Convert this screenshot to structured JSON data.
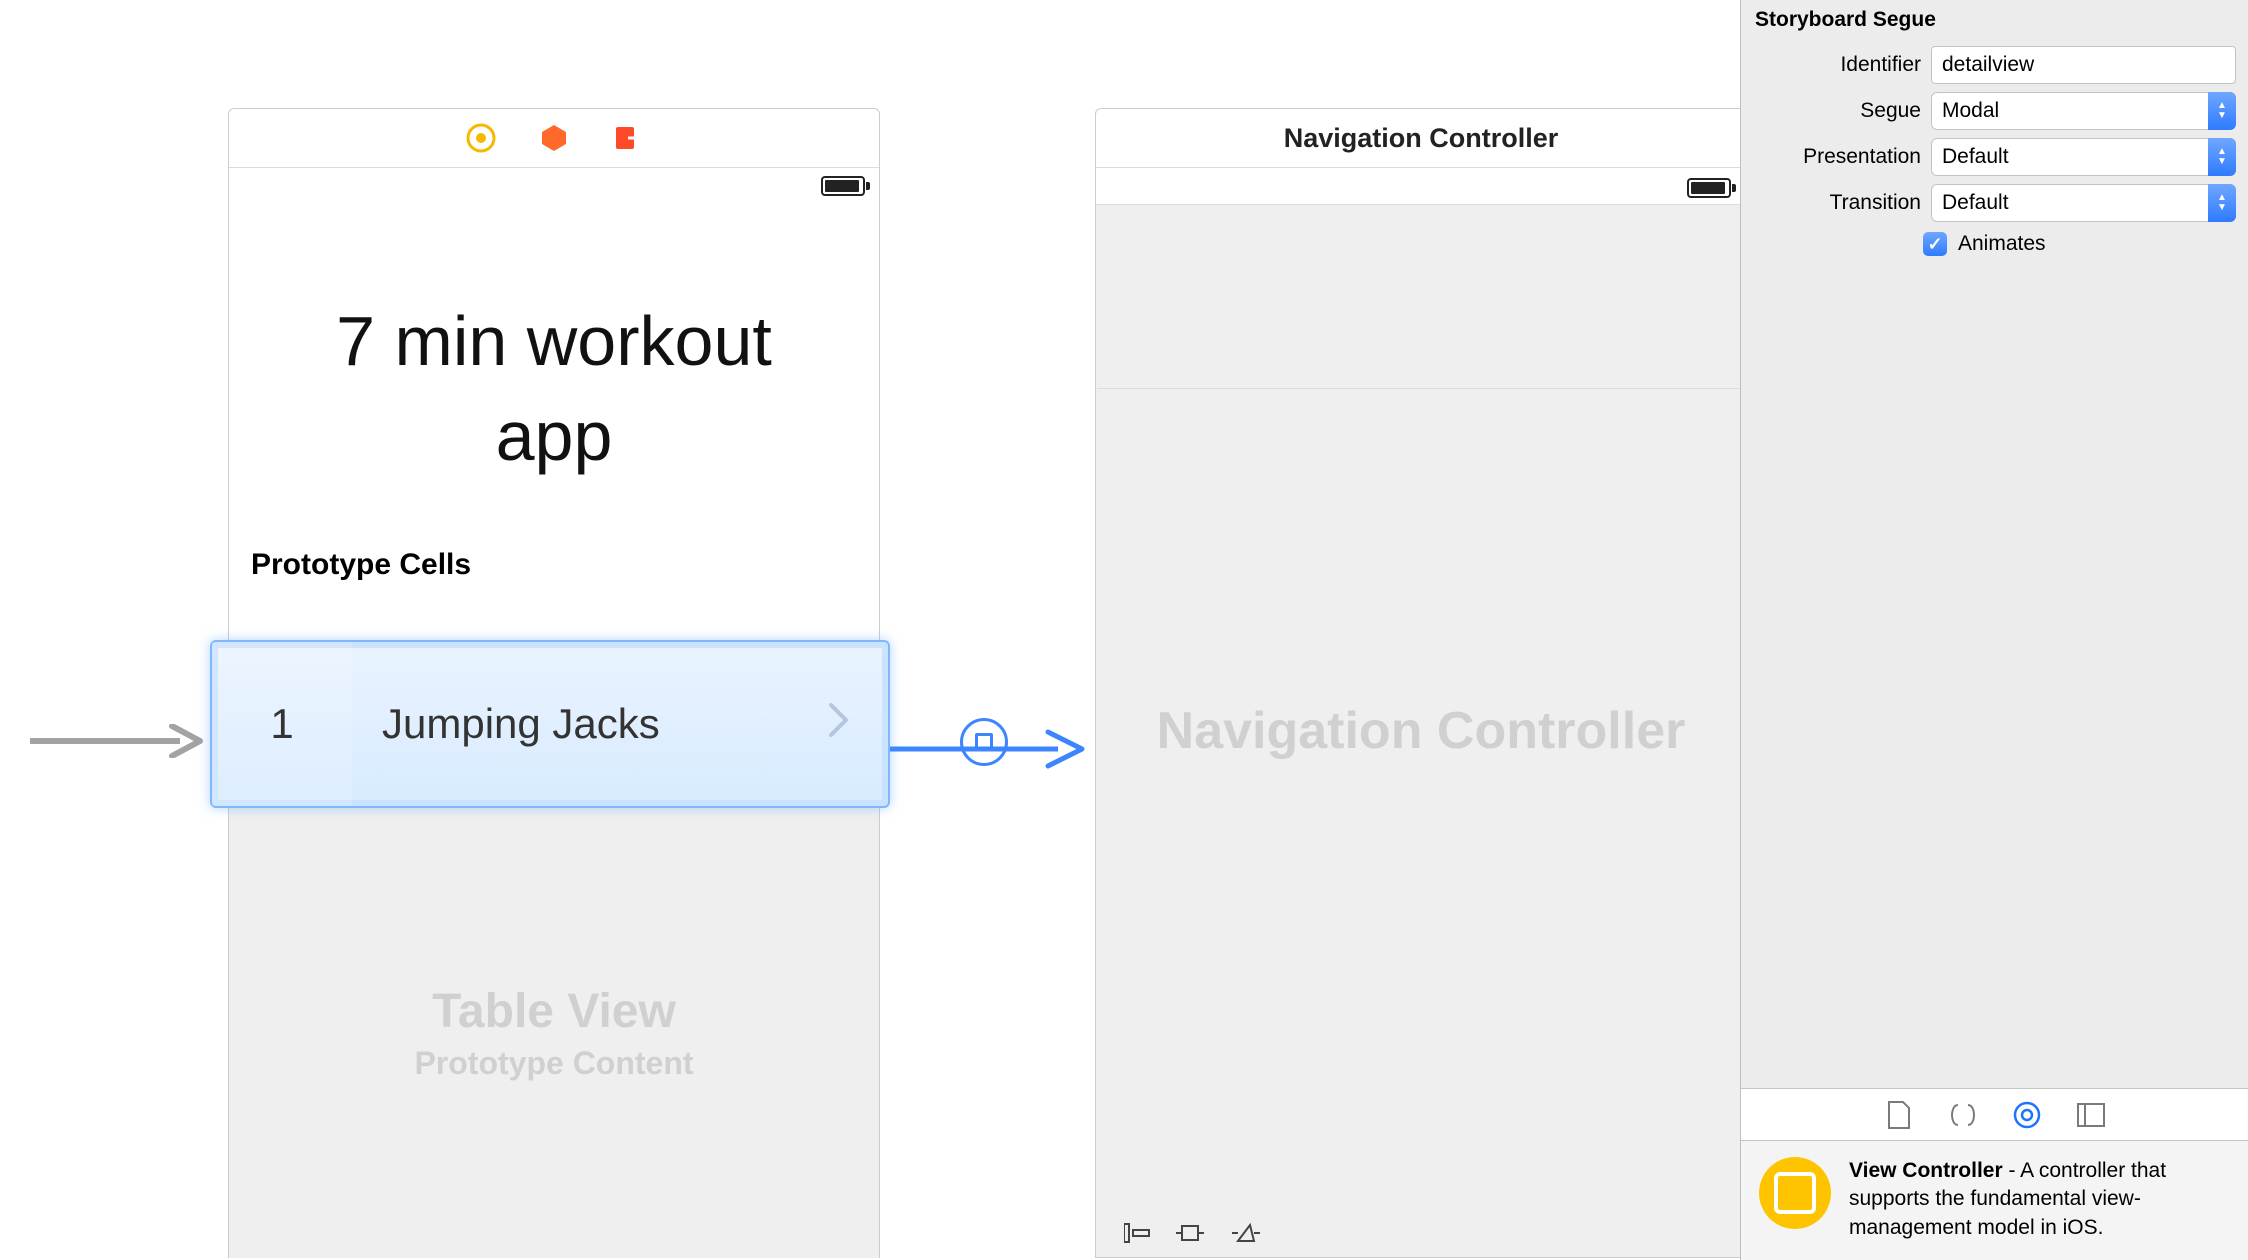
{
  "canvas": {
    "vc_dock_icons": [
      "view-controller-icon",
      "first-responder-icon",
      "exit-icon"
    ],
    "app_title_line1": "7 min workout",
    "app_title_line2": "app",
    "prototype_header": "Prototype Cells",
    "cell_number": "1",
    "cell_title": "Jumping Jacks",
    "tableview_title": "Table View",
    "tableview_subtitle": "Prototype Content",
    "nav_dock_title": "Navigation Controller",
    "nav_watermark": "Navigation Controller"
  },
  "inspector": {
    "section_header": "Storyboard Segue",
    "identifier_label": "Identifier",
    "identifier_value": "detailview",
    "segue_label": "Segue",
    "segue_value": "Modal",
    "presentation_label": "Presentation",
    "presentation_value": "Default",
    "transition_label": "Transition",
    "transition_value": "Default",
    "animates_label": "Animates",
    "animates_checked": true
  },
  "library": {
    "item_title": "View Controller",
    "item_description": " - A controller that supports the fundamental view-management model in iOS."
  }
}
